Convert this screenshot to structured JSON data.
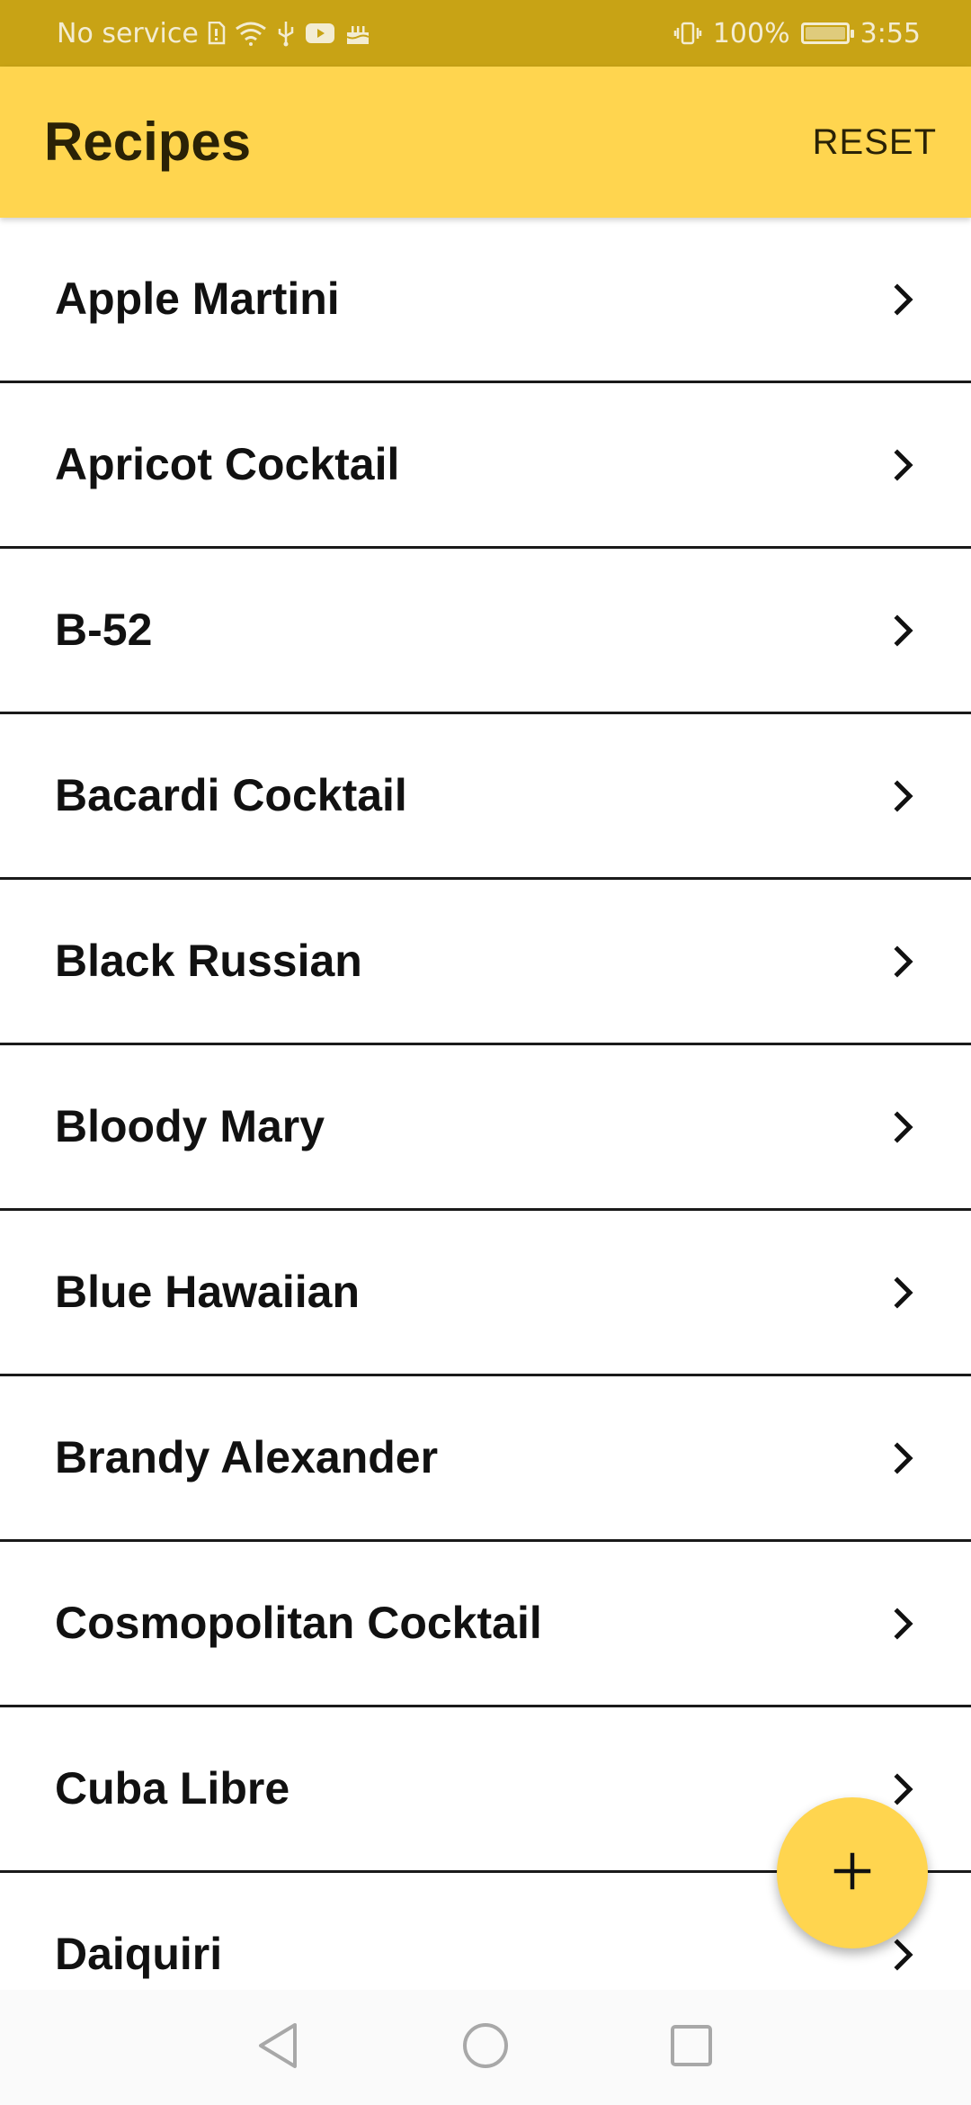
{
  "status_bar": {
    "carrier": "No service",
    "battery": "100%",
    "battery_level": 1.0,
    "time": "3:55"
  },
  "app_bar": {
    "title": "Recipes",
    "reset_label": "RESET"
  },
  "recipes": [
    {
      "name": "Apple Martini"
    },
    {
      "name": "Apricot Cocktail"
    },
    {
      "name": "B-52"
    },
    {
      "name": "Bacardi Cocktail"
    },
    {
      "name": "Black Russian"
    },
    {
      "name": "Bloody Mary"
    },
    {
      "name": "Blue Hawaiian"
    },
    {
      "name": "Brandy Alexander"
    },
    {
      "name": "Cosmopolitan Cocktail"
    },
    {
      "name": "Cuba Libre"
    },
    {
      "name": "Daiquiri"
    }
  ],
  "fab": {
    "icon": "plus-icon"
  },
  "nav": {
    "back_icon": "back-triangle-icon",
    "home_icon": "home-circle-icon",
    "recents_icon": "recents-square-icon"
  },
  "colors": {
    "status_bar": "#c8a315",
    "accent": "#ffd54f",
    "text": "#111111"
  }
}
